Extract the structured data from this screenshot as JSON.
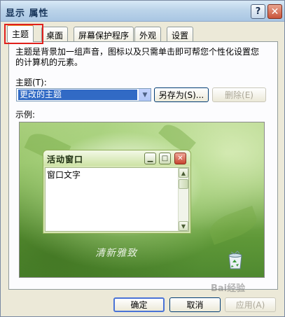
{
  "window": {
    "title": "显示 属性",
    "help_label": "?",
    "close_label": "✕"
  },
  "tabs": [
    {
      "label": "主题",
      "active": true
    },
    {
      "label": "桌面"
    },
    {
      "label": "屏幕保护程序"
    },
    {
      "label": "外观"
    },
    {
      "label": "设置"
    }
  ],
  "theme_page": {
    "description": "主题是背景加一组声音，图标以及只需单击即可帮您个性化设置您的计算机的元素。",
    "theme_label": "主题(T):",
    "theme_selected": "更改的主题",
    "save_as_label": "另存为(S)...",
    "delete_label": "删除(E)",
    "example_label": "示例:"
  },
  "preview": {
    "watermark": "清新雅致",
    "mini_window": {
      "title": "活动窗口",
      "body_text": "窗口文字"
    }
  },
  "footer": {
    "ok_label": "确定",
    "cancel_label": "取消",
    "apply_label": "应用(A)"
  },
  "overlay": {
    "site_mark": "Bai经验"
  },
  "colors": {
    "highlight_box": "#e0201c",
    "selection": "#316ac5",
    "preview_green": "#8dbd5f"
  }
}
